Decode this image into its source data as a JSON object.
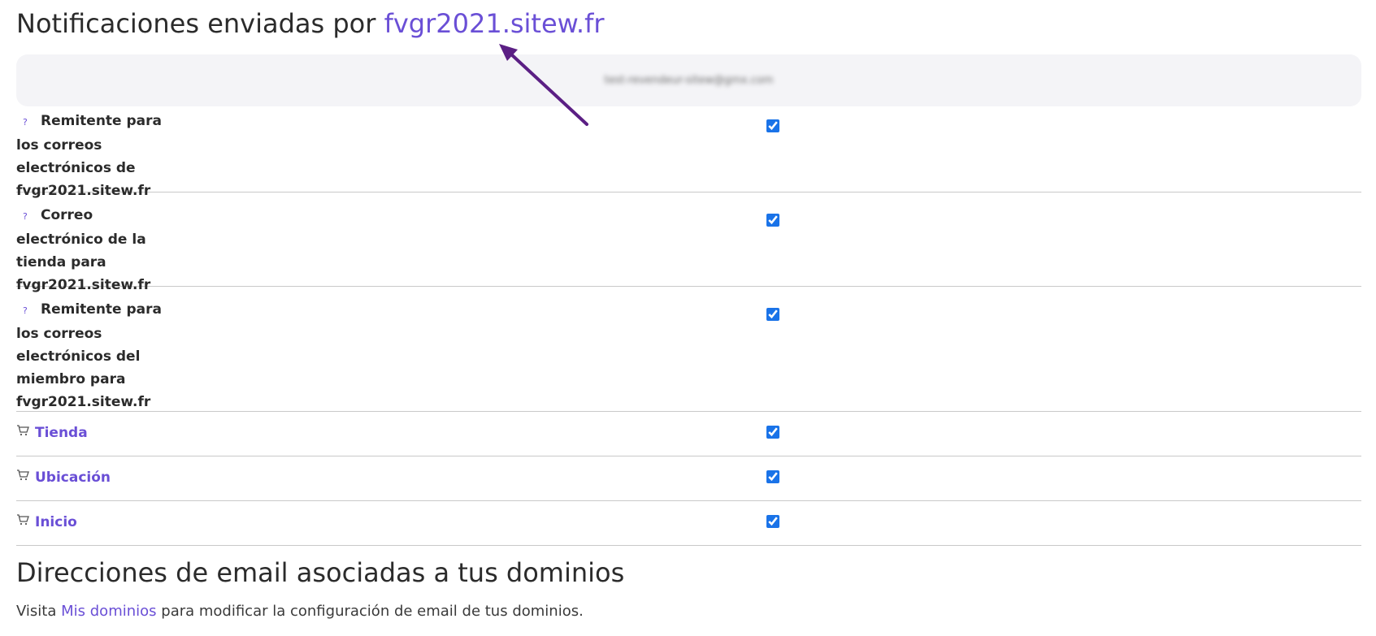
{
  "section_top": {
    "title_prefix": "Notificaciones enviadas por",
    "title_domain": "fvgr2021.sitew.fr"
  },
  "header": {
    "email_blurred": "test-revendeur-sitew@gmx.com"
  },
  "rows": [
    {
      "label": "Remitente para los correos electrónicos de fvgr2021.sitew.fr",
      "checked": true,
      "icon": "help-icon"
    },
    {
      "label": "Correo electrónico de la tienda para fvgr2021.sitew.fr",
      "checked": true,
      "icon": "help-icon"
    },
    {
      "label": "Remitente para los correos electrónicos del miembro para fvgr2021.sitew.fr",
      "checked": true,
      "icon": "help-icon"
    },
    {
      "label": "Tienda",
      "checked": true,
      "icon": "cart-icon"
    },
    {
      "label": "Ubicación",
      "checked": true,
      "icon": "cart-icon"
    },
    {
      "label": "Inicio",
      "checked": true,
      "icon": "cart-icon"
    }
  ],
  "help_glyph": "?",
  "section_bottom": {
    "title": "Direcciones de email asociadas a tus dominios",
    "text_before": "Visita",
    "link": "Mis dominios",
    "text_after": "para modificar la configuración de email de tus dominios."
  },
  "colors": {
    "accent": "#6a4fd6",
    "checkbox": "#1a73e8",
    "arrow": "#5b1f84",
    "header_bg": "#f4f4f7"
  }
}
